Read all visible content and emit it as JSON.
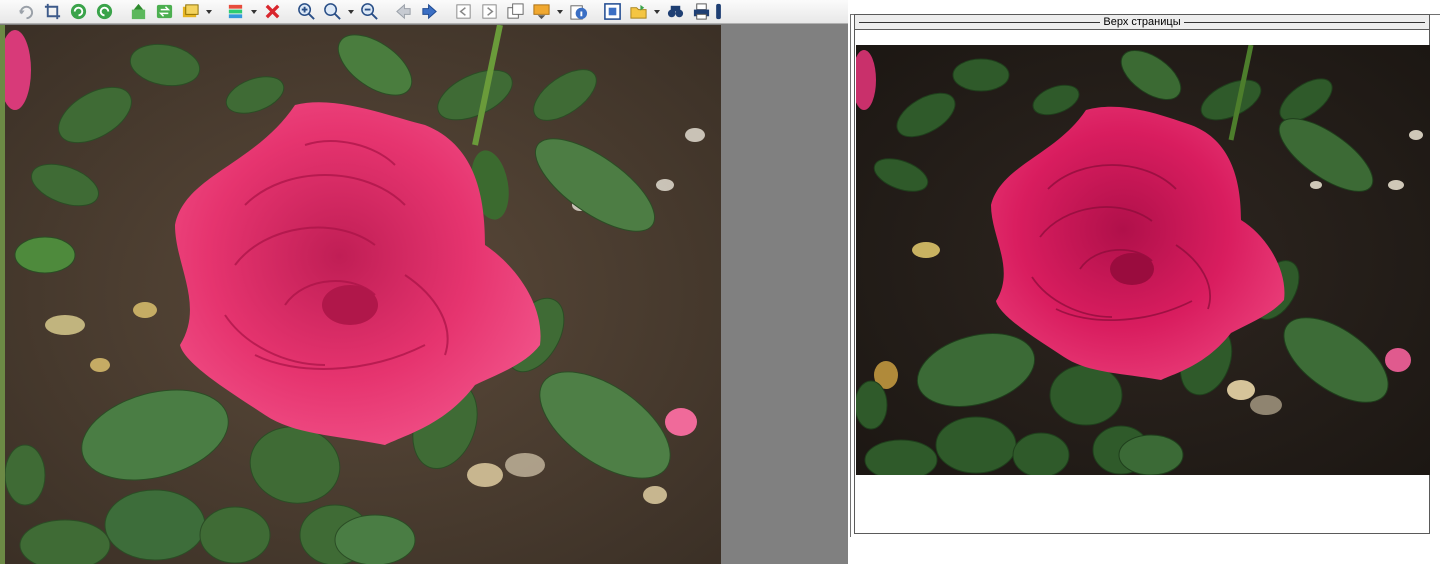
{
  "toolbar": {
    "buttons": [
      {
        "name": "undo-icon"
      },
      {
        "name": "crop-icon"
      },
      {
        "name": "rotate-left-icon"
      },
      {
        "name": "rotate-right-icon"
      },
      {
        "name": "up-folder-icon"
      },
      {
        "name": "refresh-icon"
      },
      {
        "name": "slideshow-icon"
      },
      {
        "name": "color-adjust-icon"
      },
      {
        "name": "delete-icon"
      },
      {
        "name": "zoom-in-icon"
      },
      {
        "name": "zoom-icon"
      },
      {
        "name": "zoom-out-icon"
      },
      {
        "name": "previous-icon"
      },
      {
        "name": "next-icon"
      },
      {
        "name": "first-page-icon"
      },
      {
        "name": "last-page-icon"
      },
      {
        "name": "copy-icon"
      },
      {
        "name": "export-icon"
      },
      {
        "name": "info-icon"
      },
      {
        "name": "fit-icon"
      },
      {
        "name": "open-icon"
      },
      {
        "name": "find-icon"
      },
      {
        "name": "print-icon"
      }
    ]
  },
  "preview": {
    "region_title": "Верх страницы"
  },
  "colors": {
    "rose": "#e0316e",
    "leaf": "#3f6b35",
    "soil": "#4a3b2e"
  }
}
